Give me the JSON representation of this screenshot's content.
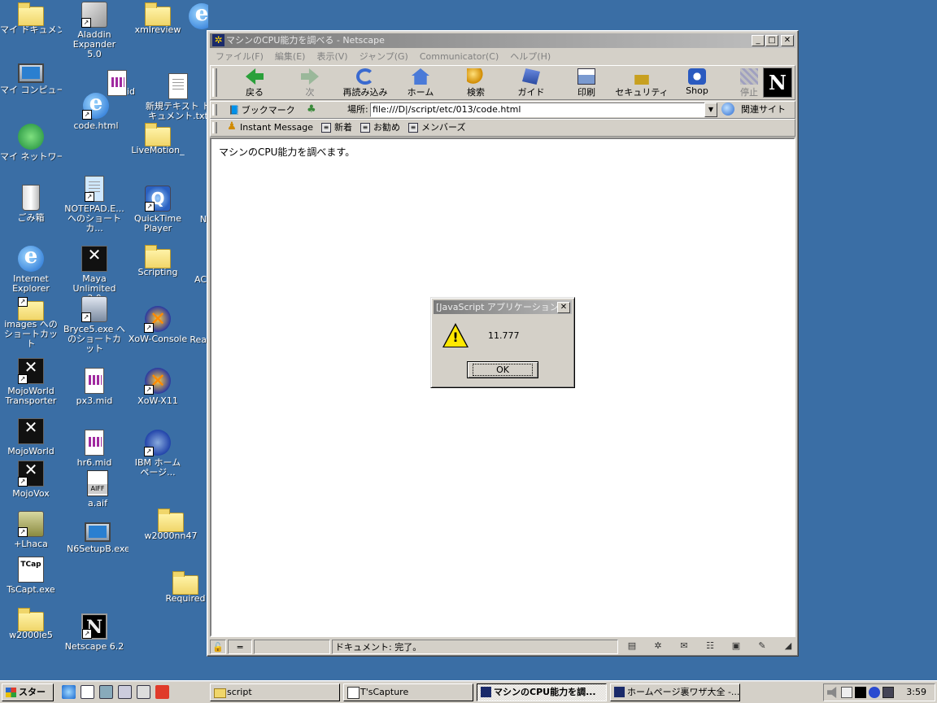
{
  "desktop": {
    "icons": [
      {
        "label": "マイ ドキュメント",
        "icon": "folder-icon"
      },
      {
        "label": "Aladdin Expander 5.0",
        "icon": "aladdin-icon"
      },
      {
        "label": "xmlreview",
        "icon": "folder-icon"
      },
      {
        "label": "code.html",
        "icon": "ie-html-icon"
      },
      {
        "label": "マイ コンピュータ",
        "icon": "computer-icon"
      },
      {
        "label": ".mid",
        "icon": "midi-file-icon"
      },
      {
        "label": "新規テキスト ドキュメント.txt",
        "icon": "text-file-icon"
      },
      {
        "label": "LiveMotion_",
        "icon": "folder-icon"
      },
      {
        "label": "マイ ネットワーク",
        "icon": "network-icon"
      },
      {
        "label": "ごみ箱",
        "icon": "recycle-bin-icon"
      },
      {
        "label": "NOTEPAD.E... へのショートカ...",
        "icon": "notepad-shortcut-icon"
      },
      {
        "label": "QuickTime Player",
        "icon": "quicktime-icon"
      },
      {
        "label": "N",
        "icon": "partial-icon"
      },
      {
        "label": "Internet Explorer",
        "icon": "ie-icon"
      },
      {
        "label": "Maya Unlimited 3.0",
        "icon": "maya-icon"
      },
      {
        "label": "Scripting",
        "icon": "folder-icon"
      },
      {
        "label": "AC",
        "icon": "partial-icon"
      },
      {
        "label": "images へのショートカット",
        "icon": "folder-shortcut-icon"
      },
      {
        "label": "Bryce5.exe へのショートカット",
        "icon": "bryce-icon"
      },
      {
        "label": "XoW-Console",
        "icon": "xow-icon"
      },
      {
        "label": "Rea",
        "icon": "partial-icon"
      },
      {
        "label": "MojoWorld Transporter",
        "icon": "mojoworld-icon"
      },
      {
        "label": "px3.mid",
        "icon": "midi-file-icon"
      },
      {
        "label": "XoW-X11",
        "icon": "xow-icon"
      },
      {
        "label": "MojoWorld",
        "icon": "mojoworld-icon"
      },
      {
        "label": "hr6.mid",
        "icon": "midi-file-icon"
      },
      {
        "label": "IBM ホームページ...",
        "icon": "ibm-icon"
      },
      {
        "label": "MojoVox",
        "icon": "mojovox-icon"
      },
      {
        "label": "a.aif",
        "icon": "aiff-file-icon"
      },
      {
        "label": "+Lhaca",
        "icon": "lhaca-icon"
      },
      {
        "label": "N6SetupB.exe",
        "icon": "setup-icon"
      },
      {
        "label": "w2000nn47",
        "icon": "folder-icon"
      },
      {
        "label": "TsCapt.exe",
        "icon": "tscapt-icon"
      },
      {
        "label": "Required",
        "icon": "folder-icon"
      },
      {
        "label": "w2000ie5",
        "icon": "folder-icon"
      },
      {
        "label": "Netscape 6.2",
        "icon": "netscape-icon"
      }
    ]
  },
  "browser": {
    "title": "マシンのCPU能力を調べる - Netscape",
    "window_buttons": {
      "minimize": "_",
      "maximize": "□",
      "close": "✕"
    },
    "menu": [
      "ファイル(F)",
      "編集(E)",
      "表示(V)",
      "ジャンプ(G)",
      "Communicator(C)",
      "ヘルプ(H)"
    ],
    "toolbar": [
      {
        "label": "戻る",
        "icon": "back-arrow-icon",
        "enabled": true
      },
      {
        "label": "次",
        "icon": "forward-arrow-icon",
        "enabled": false
      },
      {
        "label": "再読み込み",
        "icon": "reload-icon",
        "enabled": true
      },
      {
        "label": "ホーム",
        "icon": "home-icon",
        "enabled": true
      },
      {
        "label": "検索",
        "icon": "search-icon",
        "enabled": true
      },
      {
        "label": "ガイド",
        "icon": "guide-icon",
        "enabled": true
      },
      {
        "label": "印刷",
        "icon": "print-icon",
        "enabled": true
      },
      {
        "label": "セキュリティ",
        "icon": "security-icon",
        "enabled": true
      },
      {
        "label": "Shop",
        "icon": "shop-icon",
        "enabled": true
      },
      {
        "label": "停止",
        "icon": "stop-icon",
        "enabled": false
      }
    ],
    "location": {
      "bookmarks_label": "ブックマーク",
      "location_label": "場所:",
      "url": "file:///D|/script/etc/013/code.html",
      "related_label": "関連サイト"
    },
    "personal_toolbar": [
      "Instant Message",
      "新着",
      "お勧め",
      "メンバーズ"
    ],
    "page_text": "マシンのCPU能力を調べます。",
    "status_text": "ドキュメント: 完了。"
  },
  "dialog": {
    "title": "[JavaScript アプリケーション]",
    "message": "11.777",
    "ok_label": "OK",
    "close": "✕"
  },
  "taskbar": {
    "start_label": "スタート",
    "tasks": [
      "script",
      "T'sCapture",
      "マシンのCPU能力を調...",
      "ホームページ裏ワザ大全 -..."
    ],
    "active_task_index": 2,
    "clock": "3:59"
  }
}
